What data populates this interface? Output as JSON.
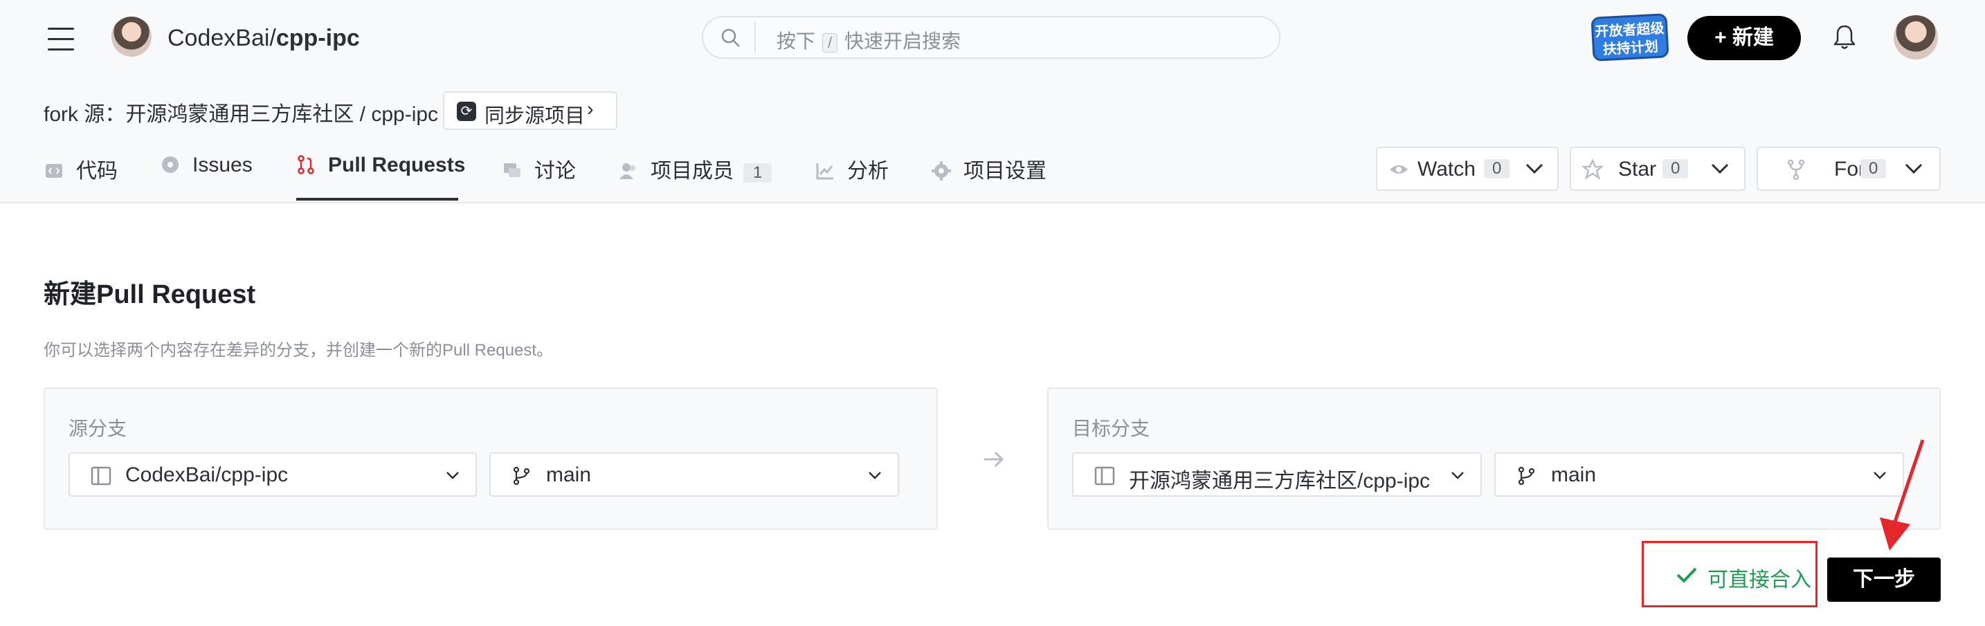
{
  "header": {
    "owner": "CodexBai/",
    "repo": "cpp-ipc",
    "search_prefix": "按下",
    "search_key": "/",
    "search_suffix": "快速开启搜索",
    "badge_text": "开放者超级扶持计划",
    "new_button": "+ 新建"
  },
  "fork": {
    "text": "fork 源：开源鸿蒙通用三方库社区 / cpp-ipc",
    "sync_button": "同步源项目"
  },
  "tabs": [
    {
      "label": "代码"
    },
    {
      "label": "Issues"
    },
    {
      "label": "Pull Requests"
    },
    {
      "label": "讨论"
    },
    {
      "label": "项目成员",
      "count": "1"
    },
    {
      "label": "分析"
    },
    {
      "label": "项目设置"
    }
  ],
  "repo_actions": {
    "watch": {
      "label": "Watch",
      "count": "0"
    },
    "star": {
      "label": "Star",
      "count": "0"
    },
    "fork": {
      "label": "Fork",
      "count": "0"
    }
  },
  "main": {
    "title": "新建Pull Request",
    "description": "你可以选择两个内容存在差异的分支，并创建一个新的Pull Request。",
    "source": {
      "label": "源分支",
      "repo": "CodexBai/cpp-ipc",
      "branch": "main"
    },
    "target": {
      "label": "目标分支",
      "repo": "开源鸿蒙通用三方库社区/cpp-ipc",
      "branch": "main"
    },
    "merge_status": "可直接合入",
    "next_button": "下一步"
  },
  "colors": {
    "accent_active": "#e5262b",
    "success": "#1f9d55",
    "annotation_red": "#e5262b",
    "primary_button": "#000000"
  }
}
